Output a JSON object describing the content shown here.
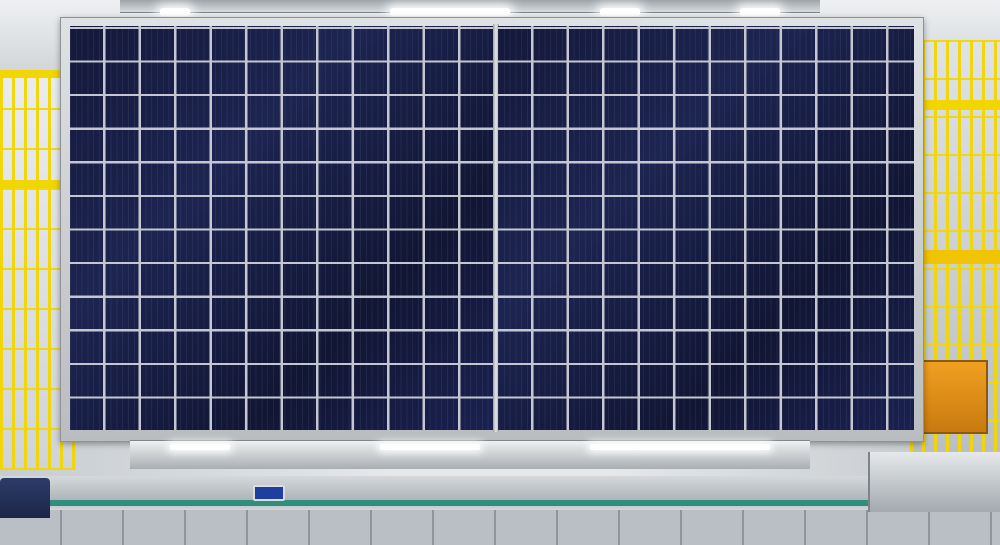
{
  "scene": {
    "subject": "",
    "colors": {
      "cell": "#151a3e",
      "busbar": "#c4c7d2",
      "frame": "#c9cdd0",
      "fence": "#f2d600",
      "belt": "#2f8f7a"
    }
  }
}
